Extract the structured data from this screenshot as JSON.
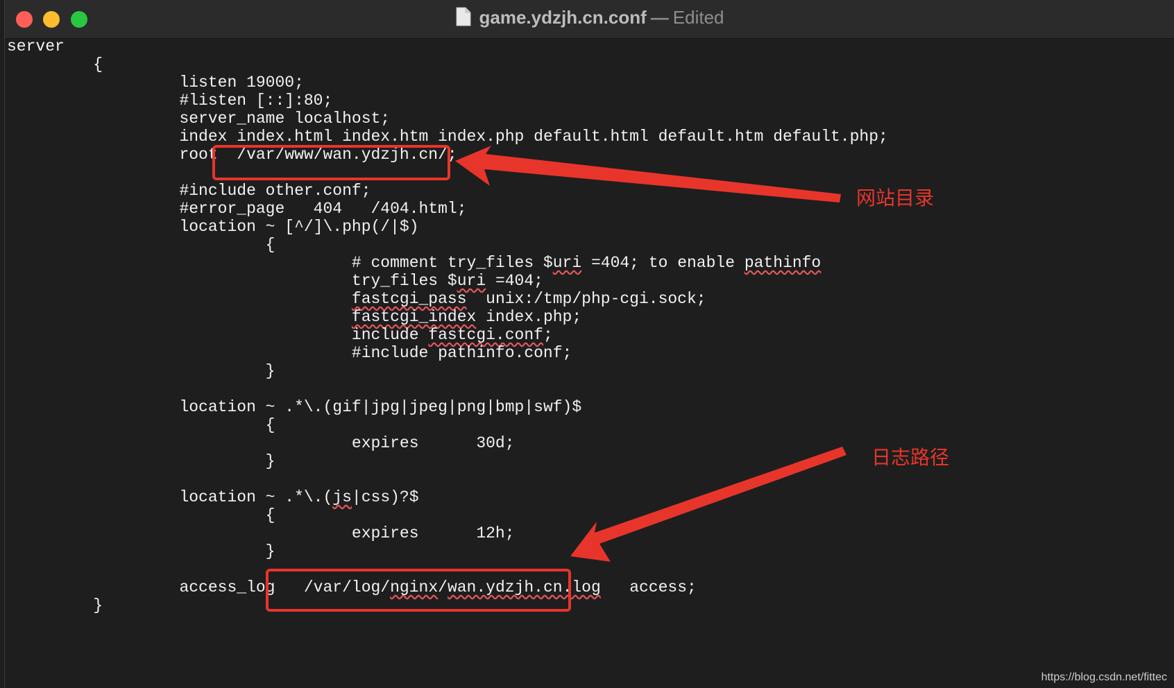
{
  "window": {
    "title_file": "game.ydzjh.cn.conf",
    "title_separator": "—",
    "title_status": "Edited",
    "icons": [
      "close-button",
      "minimize-button",
      "zoom-button",
      "document-icon"
    ]
  },
  "code_lines": [
    {
      "indent": 0,
      "parts": [
        {
          "t": "server"
        }
      ]
    },
    {
      "indent": 1,
      "parts": [
        {
          "t": "{"
        }
      ]
    },
    {
      "indent": 2,
      "parts": [
        {
          "t": "listen 19000;"
        }
      ]
    },
    {
      "indent": 2,
      "parts": [
        {
          "t": "#listen [::]:80;"
        }
      ]
    },
    {
      "indent": 2,
      "parts": [
        {
          "t": "server_name localhost;"
        }
      ]
    },
    {
      "indent": 2,
      "parts": [
        {
          "t": "index index.html index.htm index.php default.html default.htm default.php;"
        }
      ]
    },
    {
      "indent": 2,
      "parts": [
        {
          "t": "root  /var/www/wan.ydzjh.cn/;"
        }
      ]
    },
    {
      "indent": 0,
      "parts": []
    },
    {
      "indent": 2,
      "parts": [
        {
          "t": "#include other.conf;"
        }
      ]
    },
    {
      "indent": 2,
      "parts": [
        {
          "t": "#error_page   404   /404.html;"
        }
      ]
    },
    {
      "indent": 2,
      "parts": [
        {
          "t": "location ~ [^/]\\.php(/|$)"
        }
      ]
    },
    {
      "indent": 3,
      "parts": [
        {
          "t": "{"
        }
      ]
    },
    {
      "indent": 4,
      "parts": [
        {
          "t": "# comment try_files $"
        },
        {
          "t": "uri",
          "sq": true
        },
        {
          "t": " =404; to enable "
        },
        {
          "t": "pathinfo",
          "sq": true
        }
      ]
    },
    {
      "indent": 4,
      "parts": [
        {
          "t": "try_files $"
        },
        {
          "t": "uri",
          "sq": true
        },
        {
          "t": " =404;"
        }
      ]
    },
    {
      "indent": 4,
      "parts": [
        {
          "t": "fastcgi_pass",
          "sq": true
        },
        {
          "t": "  unix:/tmp/php-cgi.sock;"
        }
      ]
    },
    {
      "indent": 4,
      "parts": [
        {
          "t": "fastcgi_index",
          "sq": true
        },
        {
          "t": " index.php;"
        }
      ]
    },
    {
      "indent": 4,
      "parts": [
        {
          "t": "include "
        },
        {
          "t": "fastcgi.conf",
          "sq": true
        },
        {
          "t": ";"
        }
      ]
    },
    {
      "indent": 4,
      "parts": [
        {
          "t": "#include pathinfo.conf;"
        }
      ]
    },
    {
      "indent": 3,
      "parts": [
        {
          "t": "}"
        }
      ]
    },
    {
      "indent": 0,
      "parts": []
    },
    {
      "indent": 2,
      "parts": [
        {
          "t": "location ~ .*\\.(gif|jpg|jpeg|png|bmp|swf)$"
        }
      ]
    },
    {
      "indent": 3,
      "parts": [
        {
          "t": "{"
        }
      ]
    },
    {
      "indent": 4,
      "parts": [
        {
          "t": "expires      30d;"
        }
      ]
    },
    {
      "indent": 3,
      "parts": [
        {
          "t": "}"
        }
      ]
    },
    {
      "indent": 0,
      "parts": []
    },
    {
      "indent": 2,
      "parts": [
        {
          "t": "location ~ .*\\.("
        },
        {
          "t": "js",
          "sq": true
        },
        {
          "t": "|css)?$"
        }
      ]
    },
    {
      "indent": 3,
      "parts": [
        {
          "t": "{"
        }
      ]
    },
    {
      "indent": 4,
      "parts": [
        {
          "t": "expires      12h;"
        }
      ]
    },
    {
      "indent": 3,
      "parts": [
        {
          "t": "}"
        }
      ]
    },
    {
      "indent": 0,
      "parts": []
    },
    {
      "indent": 2,
      "parts": [
        {
          "t": "access_log   /var/log/"
        },
        {
          "t": "nginx",
          "sq": true
        },
        {
          "t": "/"
        },
        {
          "t": "wan.ydzjh.cn.log",
          "sq": true
        },
        {
          "t": "   access;"
        }
      ]
    },
    {
      "indent": 1,
      "parts": [
        {
          "t": "}"
        }
      ]
    }
  ],
  "annotations": {
    "root_label": "网站目录",
    "log_label": "日志路径",
    "color": "#e8352b"
  },
  "watermark": "https://blog.csdn.net/fittec"
}
